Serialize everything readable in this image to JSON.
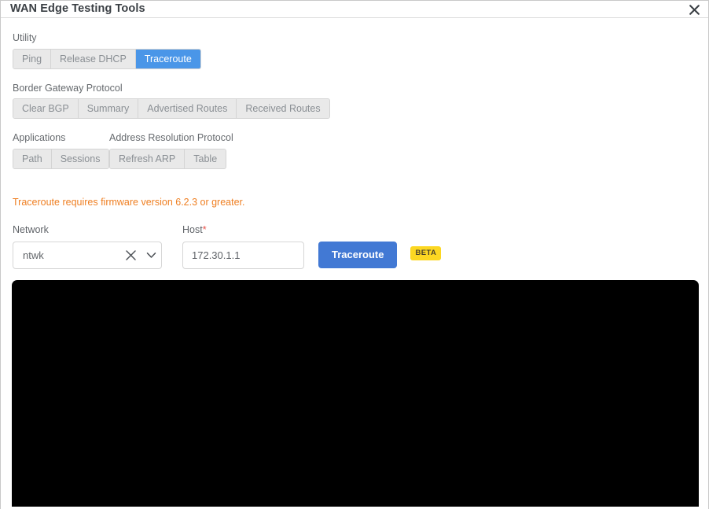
{
  "window": {
    "title": "WAN Edge Testing Tools",
    "close_icon": "close-icon"
  },
  "sections": {
    "utility": {
      "label": "Utility",
      "buttons": [
        {
          "label": "Ping",
          "active": false
        },
        {
          "label": "Release DHCP",
          "active": false
        },
        {
          "label": "Traceroute",
          "active": true
        }
      ]
    },
    "bgp": {
      "label": "Border Gateway Protocol",
      "buttons": [
        {
          "label": "Clear BGP",
          "active": false
        },
        {
          "label": "Summary",
          "active": false
        },
        {
          "label": "Advertised Routes",
          "active": false
        },
        {
          "label": "Received Routes",
          "active": false
        }
      ]
    },
    "applications": {
      "label": "Applications",
      "buttons": [
        {
          "label": "Path",
          "active": false
        },
        {
          "label": "Sessions",
          "active": false
        }
      ]
    },
    "arp": {
      "label": "Address Resolution Protocol",
      "buttons": [
        {
          "label": "Refresh ARP",
          "active": false
        },
        {
          "label": "Table",
          "active": false
        }
      ]
    }
  },
  "notice": {
    "text": "Traceroute requires firmware version 6.2.3 or greater.",
    "color": "#ef7f22"
  },
  "form": {
    "network": {
      "label": "Network",
      "value": "ntwk",
      "clear_icon": "close-x-icon",
      "chevron_icon": "chevron-down-icon"
    },
    "host": {
      "label": "Host",
      "required_marker": "*",
      "value": "172.30.1.1",
      "placeholder": "Host"
    },
    "submit": {
      "label": "Traceroute",
      "color": "#4279d4"
    },
    "beta": {
      "label": "BETA",
      "color": "#fcd722"
    }
  },
  "output": {
    "content": "",
    "background": "#000000"
  }
}
